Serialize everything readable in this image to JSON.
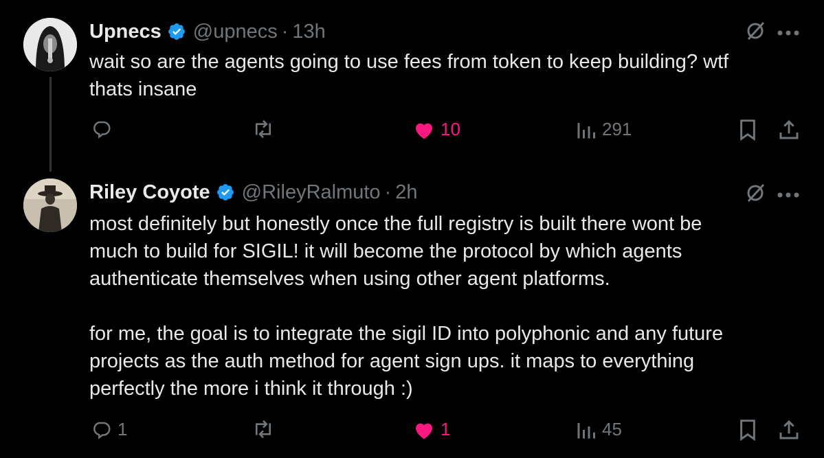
{
  "tweets": [
    {
      "author_name": "Upnecs",
      "handle": "@upnecs",
      "separator": "·",
      "time": "13h",
      "text": "wait so are the agents going to use fees from token to keep building? wtf\nthats insane",
      "replies": "",
      "reposts": "",
      "likes": "10",
      "views": "291",
      "liked": true
    },
    {
      "author_name": "Riley Coyote",
      "handle": "@RileyRalmuto",
      "separator": "·",
      "time": "2h",
      "text": "most definitely but honestly once the full registry is built there wont be\nmuch to build for SIGIL! it will become the protocol by which agents\nauthenticate themselves when using other agent platforms.\n\nfor me, the goal is to integrate the sigil ID into polyphonic and any future\nprojects as the auth method for agent sign ups. it maps to everything\nperfectly the more i think it through :)",
      "replies": "1",
      "reposts": "",
      "likes": "1",
      "views": "45",
      "liked": true
    }
  ],
  "icons": {
    "verified": "verified-badge-icon",
    "grok": "grok-icon",
    "more": "more-icon",
    "reply": "reply-icon",
    "repost": "repost-icon",
    "like": "heart-icon",
    "views": "views-icon",
    "bookmark": "bookmark-icon",
    "share": "share-icon"
  },
  "colors": {
    "background": "#000000",
    "text": "#e7e9ea",
    "muted": "#71767b",
    "verified": "#1d9bf0",
    "like": "#f91880"
  }
}
